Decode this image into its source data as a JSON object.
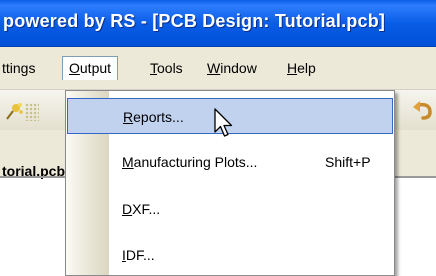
{
  "window": {
    "title": "powered by RS - [PCB Design: Tutorial.pcb]"
  },
  "menubar": {
    "items": [
      {
        "label": "ttings",
        "underline": ""
      },
      {
        "label": "Output",
        "underline": "O",
        "rest": "utput",
        "active": true
      },
      {
        "label": "Tools",
        "underline": "T",
        "rest": "ools"
      },
      {
        "label": "Window",
        "underline": "W",
        "rest": "indow"
      },
      {
        "label": "Help",
        "underline": "H",
        "rest": "elp"
      }
    ]
  },
  "document_tab": {
    "label": "torial.pcb"
  },
  "dropdown": {
    "items": [
      {
        "u": "R",
        "rest": "eports...",
        "shortcut": "",
        "highlighted": true
      },
      {
        "u": "M",
        "rest": "anufacturing Plots...",
        "shortcut": "Shift+P"
      },
      {
        "u": "D",
        "rest": "XF...",
        "shortcut": ""
      },
      {
        "u": "I",
        "rest": "DF...",
        "shortcut": ""
      }
    ]
  },
  "colors": {
    "titlebar": "#0a5de6",
    "menubar": "#ece9d8",
    "highlight_bg": "#c1d2ee",
    "highlight_border": "#316ac5"
  }
}
